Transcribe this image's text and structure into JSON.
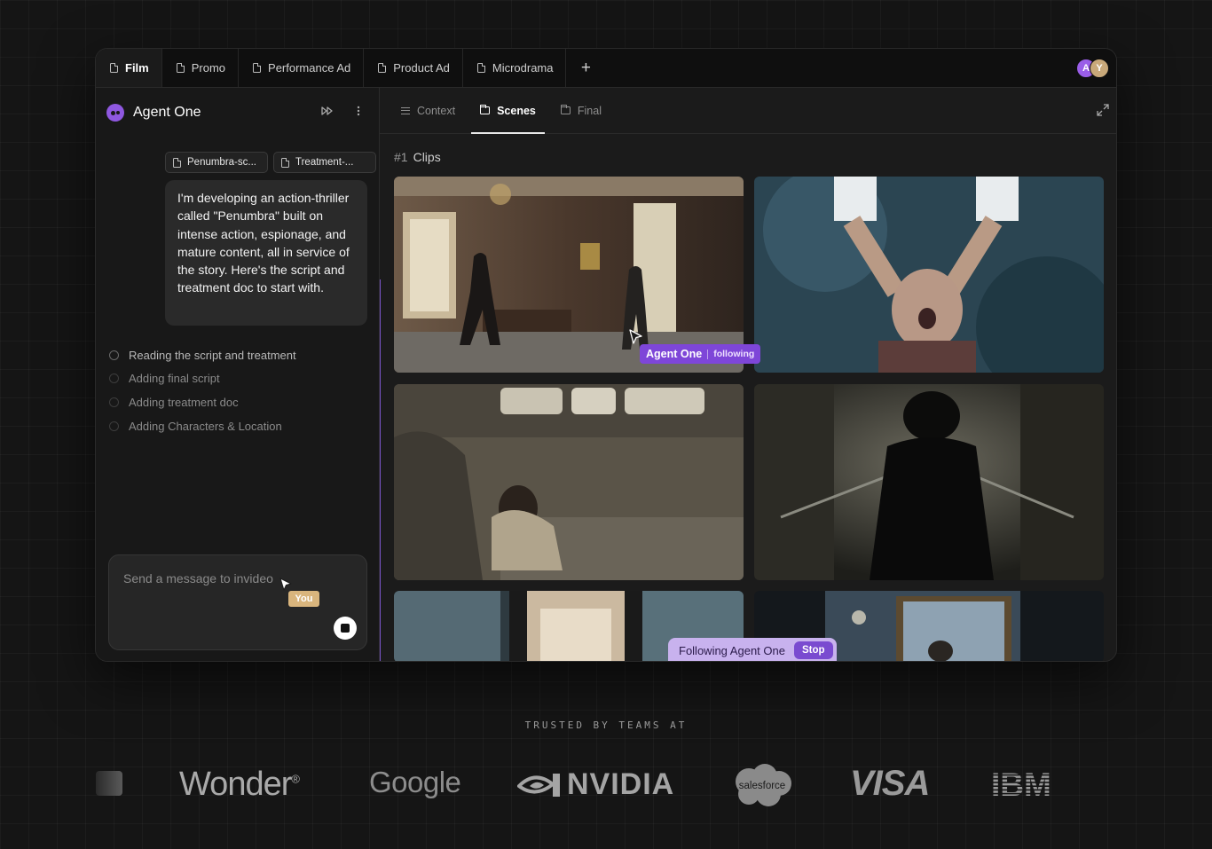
{
  "tabs": [
    {
      "label": "Film",
      "active": true
    },
    {
      "label": "Promo",
      "active": false
    },
    {
      "label": "Performance Ad",
      "active": false
    },
    {
      "label": "Product Ad",
      "active": false
    },
    {
      "label": "Microdrama",
      "active": false
    }
  ],
  "add_tab_icon": "plus-icon",
  "avatars": [
    "A",
    "Y"
  ],
  "agent": {
    "name": "Agent One",
    "attachments": [
      "Penumbra-sc...",
      "Treatment-..."
    ],
    "message": "I'm developing an action-thriller called \"Penumbra\" built on intense action, espionage, and mature content, all in service of the story. Here's the script and treatment doc to start with.",
    "steps": [
      "Reading the script and treatment",
      "Adding final script",
      "Adding treatment doc",
      "Adding Characters & Location"
    ]
  },
  "composer": {
    "placeholder": "Send a message to invideo"
  },
  "cursor_you_label": "You",
  "right_tabs": [
    {
      "label": "Context",
      "active": false,
      "icon": "list-icon"
    },
    {
      "label": "Scenes",
      "active": true,
      "icon": "folder-icon"
    },
    {
      "label": "Final",
      "active": false,
      "icon": "folder-icon"
    }
  ],
  "section": {
    "num": "#1",
    "title": "Clips"
  },
  "agent_tag": {
    "name": "Agent One",
    "status": "following"
  },
  "following_bar": {
    "text": "Following Agent One",
    "stop": "Stop"
  },
  "trusted": {
    "heading": "TRUSTED BY TEAMS AT",
    "logos": [
      "Wonder",
      "Google",
      "NVIDIA",
      "salesforce",
      "VISA",
      "IBM"
    ]
  },
  "colors": {
    "accent": "#7e46d8",
    "you": "#d9b57d"
  }
}
